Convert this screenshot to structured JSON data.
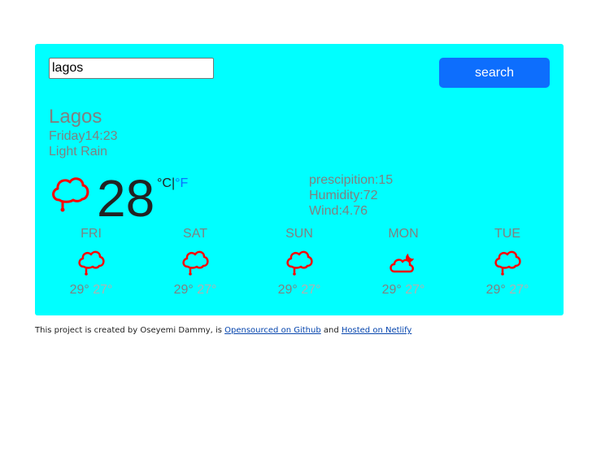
{
  "search": {
    "value": "lagos",
    "button_label": "search"
  },
  "current": {
    "city": "Lagos",
    "datetime": "Friday14:23",
    "description": "Light Rain",
    "temperature": "28",
    "unit_c": "°C",
    "unit_sep": "|",
    "unit_f": "°F",
    "icon": "rain-cloud-icon"
  },
  "details": {
    "precipitation": "prescipition:15",
    "humidity": "Humidity:72",
    "wind": "Wind:4.76"
  },
  "forecast": [
    {
      "day": "FRI",
      "max": "29°",
      "min": "27°",
      "icon": "rain-cloud-icon"
    },
    {
      "day": "SAT",
      "max": "29°",
      "min": "27°",
      "icon": "rain-cloud-icon"
    },
    {
      "day": "SUN",
      "max": "29°",
      "min": "27°",
      "icon": "rain-cloud-icon"
    },
    {
      "day": "MON",
      "max": "29°",
      "min": "27°",
      "icon": "cloud-moon-icon"
    },
    {
      "day": "TUE",
      "max": "29°",
      "min": "27°",
      "icon": "rain-cloud-icon"
    }
  ],
  "footer": {
    "text_before": "This project is created by Oseyemi Dammy, is ",
    "link1": "Opensourced on Github",
    "text_mid": " and ",
    "link2": "Hosted on Netlify"
  },
  "colors": {
    "card": "#00ffff",
    "button": "#0d6efd",
    "icon": "#ff0000",
    "muted_text": "#808080"
  }
}
